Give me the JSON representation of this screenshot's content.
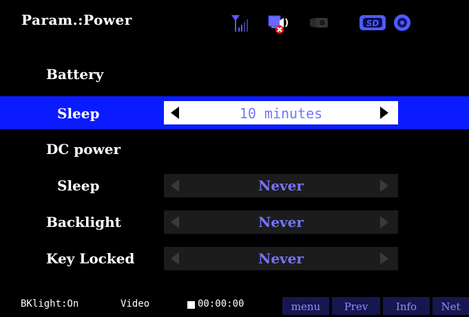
{
  "header": {
    "title": "Param.:Power",
    "icons": [
      "signal-antenna-icon",
      "monitor-speaker-muted-icon",
      "camera-icon",
      "sd-card-icon",
      "disc-icon"
    ],
    "colors": {
      "accent": "#4d5bff",
      "selection": "#0b1bff"
    }
  },
  "settings": {
    "battery_heading": "Battery",
    "battery_sleep": {
      "label": "Sleep",
      "value": "10 minutes"
    },
    "dc_heading": "DC power",
    "dc_sleep": {
      "label": "Sleep",
      "value": "Never"
    },
    "backlight": {
      "label": "Backlight",
      "value": "Never"
    },
    "key_locked": {
      "label": "Key Locked",
      "value": "Never"
    }
  },
  "footer": {
    "bklight": "BKlight:On",
    "mode": "Video",
    "timer": "00:00:00",
    "buttons": [
      "menu",
      "Prev",
      "Info",
      "Net"
    ]
  }
}
